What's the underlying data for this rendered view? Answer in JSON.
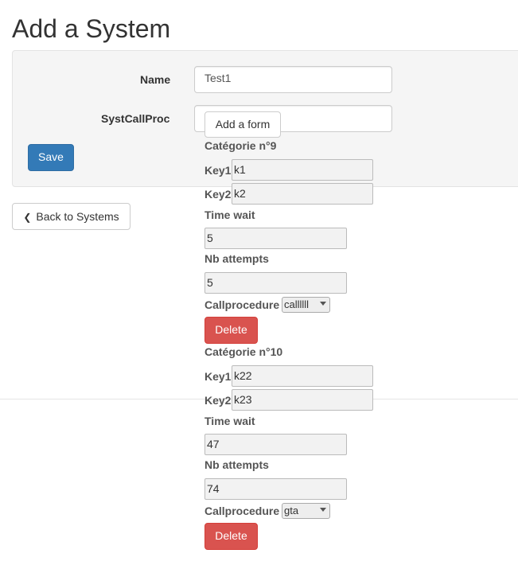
{
  "page": {
    "title": "Add a System"
  },
  "form": {
    "name_label": "Name",
    "name_value": "Test1",
    "syst_label": "SystCallProc",
    "add_form_label": "Add a form",
    "save_label": "Save"
  },
  "back_button": {
    "label": "Back to Systems"
  },
  "categories": [
    {
      "header": "Catégorie n°9",
      "key1_label": "Key1",
      "key1_value": "k1",
      "key2_label": "Key2",
      "key2_value": "k2",
      "time_wait_label": "Time wait",
      "time_wait_value": "5",
      "nb_attempts_label": "Nb attempts",
      "nb_attempts_value": "5",
      "callproc_label": "Callprocedure",
      "callproc_value": "callllll",
      "delete_label": "Delete"
    },
    {
      "header": "Catégorie n°10",
      "key1_label": "Key1",
      "key1_value": "k22",
      "key2_label": "Key2",
      "key2_value": "k23",
      "time_wait_label": "Time wait",
      "time_wait_value": "47",
      "nb_attempts_label": "Nb attempts",
      "nb_attempts_value": "74",
      "callproc_label": "Callprocedure",
      "callproc_value": "gta",
      "delete_label": "Delete"
    }
  ],
  "colors": {
    "primary": "#337ab7",
    "danger": "#d9534f",
    "panel_bg": "#f5f5f5"
  }
}
